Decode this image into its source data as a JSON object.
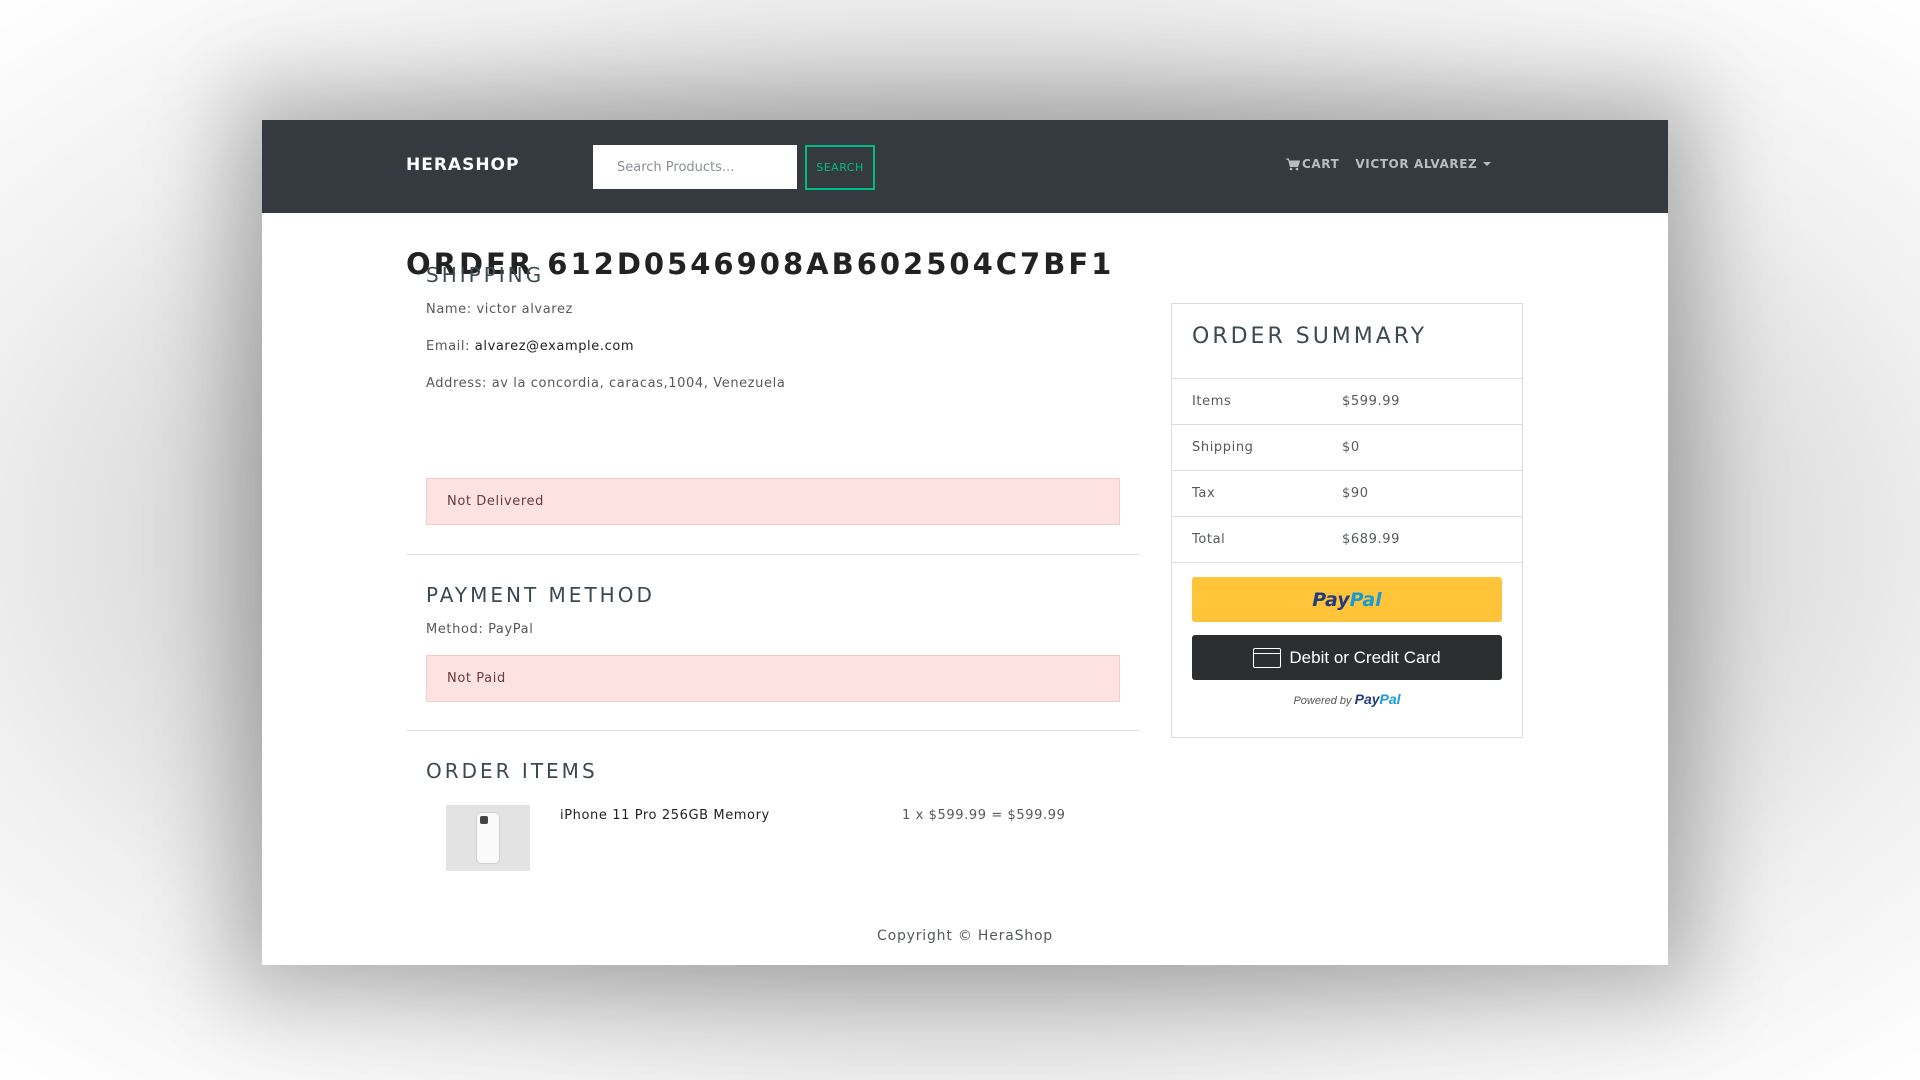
{
  "nav": {
    "brand": "HERASHOP",
    "search_placeholder": "Search Products...",
    "search_label": "SEARCH",
    "cart_label": "CART",
    "user_label": "VICTOR ALVAREZ",
    "cart_icon": "shopping-cart-icon"
  },
  "order": {
    "title": "ORDER 612D0546908AB602504C7BF1"
  },
  "shipping": {
    "heading": "SHIPPING",
    "name_label": "Name:",
    "name_value": "victor alvarez",
    "email_label": "Email:",
    "email_value": "alvarez@example.com",
    "address_label": "Address:",
    "address_value": "av la concordia, caracas,1004, Venezuela",
    "status": "Not Delivered"
  },
  "payment": {
    "heading": "PAYMENT METHOD",
    "method_label": "Method:",
    "method_value": "PayPal",
    "status": "Not Paid"
  },
  "items": {
    "heading": "ORDER ITEMS",
    "list": [
      {
        "name": "iPhone 11 Pro 256GB Memory",
        "calc": "1 x $599.99 = $599.99"
      }
    ]
  },
  "summary": {
    "heading": "ORDER SUMMARY",
    "rows": [
      {
        "label": "Items",
        "value": "$599.99"
      },
      {
        "label": "Shipping",
        "value": "$0"
      },
      {
        "label": "Tax",
        "value": "$90"
      },
      {
        "label": "Total",
        "value": "$689.99"
      }
    ],
    "paypal_a": "Pay",
    "paypal_b": "Pal",
    "card_label": "Debit or Credit Card",
    "powered_by": "Powered by"
  },
  "footer": {
    "copyright": "Copyright © HeraShop"
  },
  "colors": {
    "navbar": "#343a40",
    "accent": "#00bc8c",
    "alert_bg": "#fde2e2",
    "paypal_yellow": "#ffc439",
    "card_black": "#2c2e2f"
  }
}
